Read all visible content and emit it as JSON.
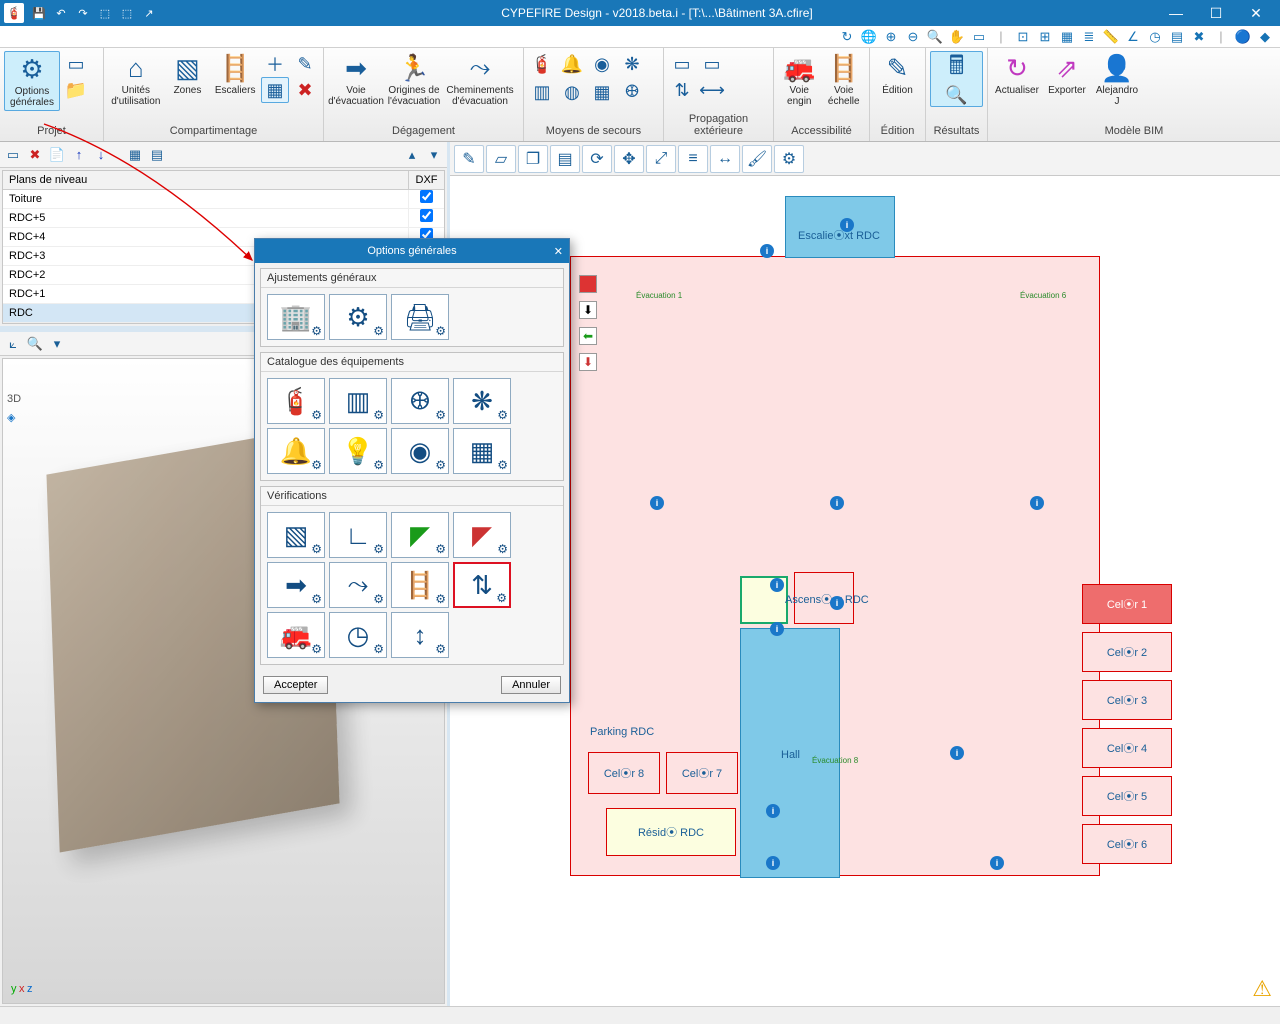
{
  "title": "CYPEFIRE Design - v2018.beta.i - [T:\\...\\Bâtiment 3A.cfire]",
  "ribbon": {
    "options": "Options générales",
    "projet": "Projet",
    "unites": "Unités d'utilisation",
    "zones": "Zones",
    "escaliers": "Escaliers",
    "compart": "Compartimentage",
    "voie_evac": "Voie d'évacuation",
    "origines": "Origines de l'évacuation",
    "chemin": "Cheminements d'évacuation",
    "degagement": "Dégagement",
    "moyens": "Moyens de secours",
    "propagation": "Propagation extérieure",
    "voie_engin": "Voie engin",
    "voie_echelle": "Voie échelle",
    "accessibilite": "Accessibilité",
    "edition_btn": "Édition",
    "edition_grp": "Édition",
    "resultats": "Résultats",
    "actualiser": "Actualiser",
    "exporter": "Exporter",
    "user": "Alejandro J",
    "modele": "Modèle BIM"
  },
  "levels": {
    "header_name": "Plans de niveau",
    "header_dxf": "DXF",
    "rows": [
      {
        "name": "Toiture",
        "checked": true
      },
      {
        "name": "RDC+5",
        "checked": true
      },
      {
        "name": "RDC+4",
        "checked": true
      },
      {
        "name": "RDC+3",
        "checked": true
      },
      {
        "name": "RDC+2",
        "checked": true
      },
      {
        "name": "RDC+1",
        "checked": true
      },
      {
        "name": "RDC",
        "checked": true
      }
    ]
  },
  "dialog": {
    "title": "Options générales",
    "sect1": "Ajustements généraux",
    "sect2": "Catalogue des équipements",
    "sect3": "Vérifications",
    "accept": "Accepter",
    "cancel": "Annuler"
  },
  "plan": {
    "evac1": "Évacuation 1",
    "evac6": "Évacuation 6",
    "evac8": "Évacuation 8",
    "escalier": "Escalie⦿xt RDC",
    "ascenseur": "Ascens⦿ur RDC",
    "parking": "Parking RDC",
    "hall": "Hall",
    "resi": "Résid⦿ RDC",
    "cell1": "Cel⦿r 1",
    "cell2": "Cel⦿r 2",
    "cell3": "Cel⦿r 3",
    "cell4": "Cel⦿r 4",
    "cell5": "Cel⦿r 5",
    "cell6": "Cel⦿r 6",
    "cell7": "Cel⦿r 7",
    "cell8": "Cel⦿r 8"
  }
}
